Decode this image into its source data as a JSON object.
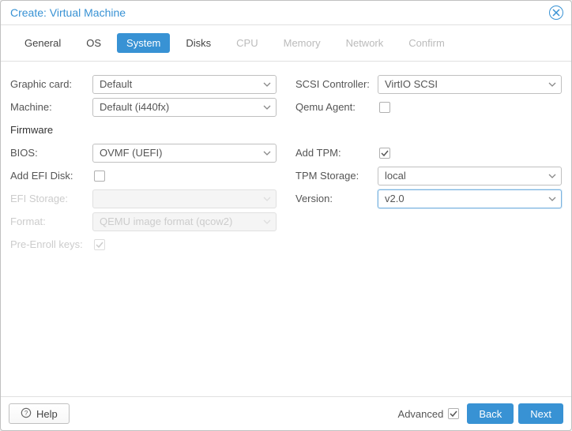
{
  "window": {
    "title": "Create: Virtual Machine"
  },
  "tabs": [
    {
      "label": "General",
      "state": "normal"
    },
    {
      "label": "OS",
      "state": "normal"
    },
    {
      "label": "System",
      "state": "active"
    },
    {
      "label": "Disks",
      "state": "normal"
    },
    {
      "label": "CPU",
      "state": "disabled"
    },
    {
      "label": "Memory",
      "state": "disabled"
    },
    {
      "label": "Network",
      "state": "disabled"
    },
    {
      "label": "Confirm",
      "state": "disabled"
    }
  ],
  "left": {
    "graphic_card": {
      "label": "Graphic card:",
      "value": "Default"
    },
    "machine": {
      "label": "Machine:",
      "value": "Default (i440fx)"
    },
    "firmware_header": "Firmware",
    "bios": {
      "label": "BIOS:",
      "value": "OVMF (UEFI)"
    },
    "add_efi_disk": {
      "label": "Add EFI Disk:",
      "checked": false
    },
    "efi_storage": {
      "label": "EFI Storage:",
      "value": ""
    },
    "format": {
      "label": "Format:",
      "value": "QEMU image format (qcow2)"
    },
    "pre_enroll": {
      "label": "Pre-Enroll keys:",
      "checked": true
    }
  },
  "right": {
    "scsi_controller": {
      "label": "SCSI Controller:",
      "value": "VirtIO SCSI"
    },
    "qemu_agent": {
      "label": "Qemu Agent:",
      "checked": false
    },
    "add_tpm": {
      "label": "Add TPM:",
      "checked": true
    },
    "tpm_storage": {
      "label": "TPM Storage:",
      "value": "local"
    },
    "version": {
      "label": "Version:",
      "value": "v2.0"
    }
  },
  "footer": {
    "help": "Help",
    "advanced": "Advanced",
    "advanced_checked": true,
    "back": "Back",
    "next": "Next"
  }
}
